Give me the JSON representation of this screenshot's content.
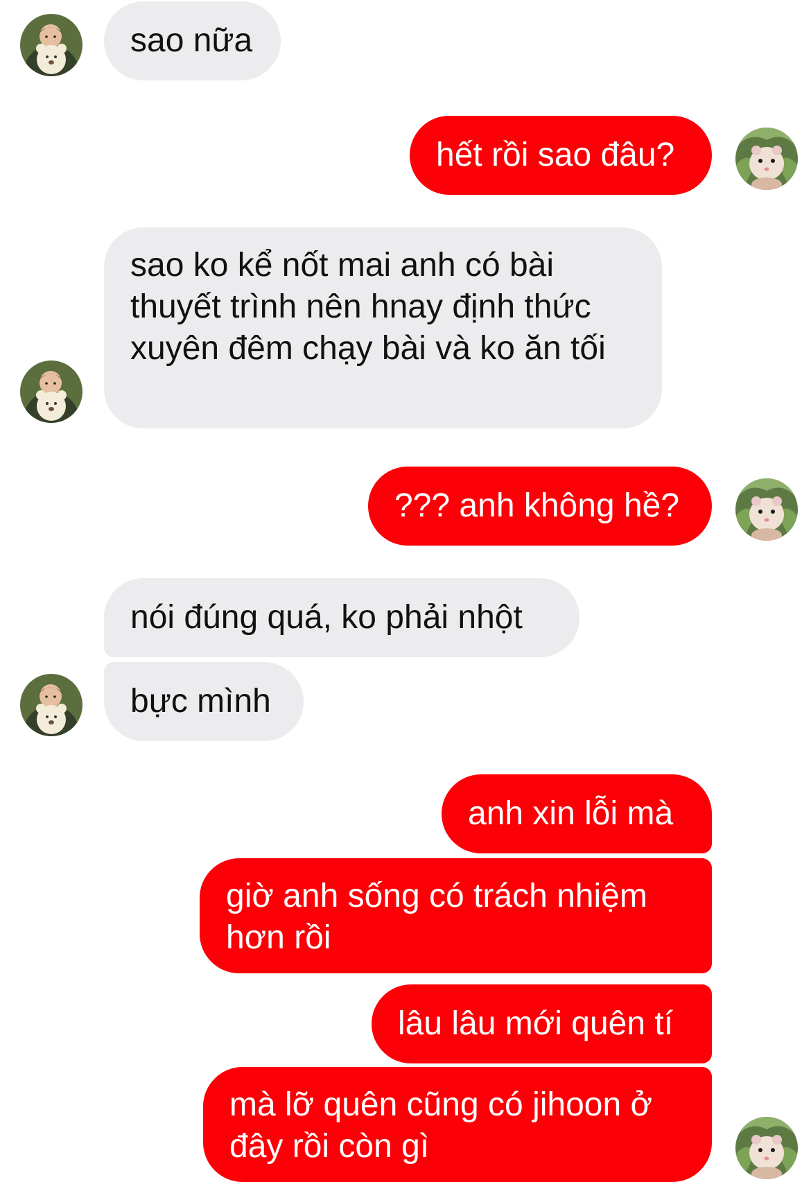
{
  "messages": [
    {
      "sender": "other",
      "text": "sao nữa"
    },
    {
      "sender": "me",
      "text": "hết rồi sao đâu?"
    },
    {
      "sender": "other",
      "text": "sao ko kể nốt mai anh có bài thuyết trình nên hnay định thức xuyên đêm chạy bài và ko ăn tối"
    },
    {
      "sender": "me",
      "text": "??? anh không hề?"
    },
    {
      "sender": "other",
      "text": "nói đúng quá, ko phải nhột"
    },
    {
      "sender": "other",
      "text": "bực mình"
    },
    {
      "sender": "me",
      "text": "anh xin lỗi mà"
    },
    {
      "sender": "me",
      "text": "giờ anh sống có trách nhiệm hơn rồi"
    },
    {
      "sender": "me",
      "text": "lâu lâu mới quên tí"
    },
    {
      "sender": "me",
      "text": "mà lỡ quên cũng có jihoon ở đây rồi còn gì"
    }
  ],
  "avatars": {
    "other": {
      "icon": "child-with-teddy-bear-photo"
    },
    "me": {
      "icon": "hamster-in-lettuce-photo"
    }
  },
  "colors": {
    "outgoing_bubble": "#fb0007",
    "incoming_bubble": "#ececee",
    "outgoing_text": "#ffffff",
    "incoming_text": "#111111",
    "background": "#ffffff"
  }
}
